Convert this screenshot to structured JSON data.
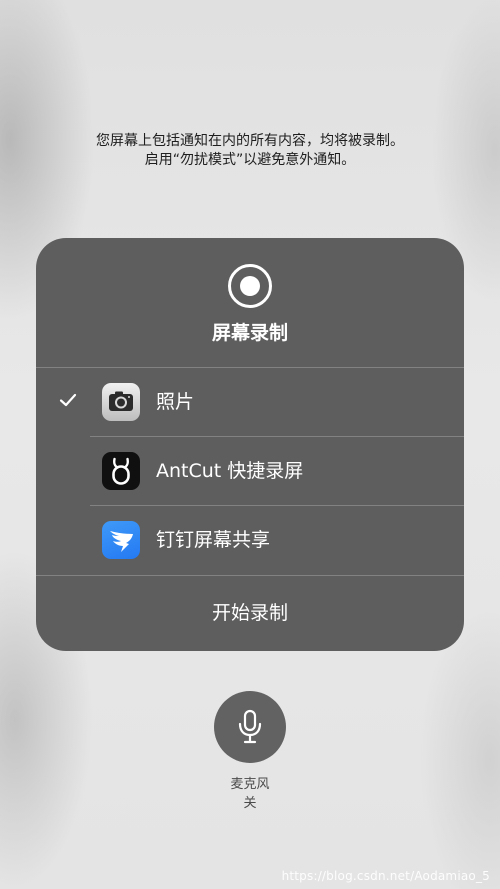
{
  "warning": {
    "line1": "您屏幕上包括通知在内的所有内容，均将被录制。",
    "line2": "启用“勿扰模式”以避免意外通知。"
  },
  "panel": {
    "icon": "record-icon",
    "title": "屏幕录制",
    "apps": [
      {
        "label": "照片",
        "icon": "photos-camera-icon",
        "selected": true
      },
      {
        "label": "AntCut 快捷录屏",
        "icon": "antcut-app-icon",
        "selected": false
      },
      {
        "label": "钉钉屏幕共享",
        "icon": "dingtalk-app-icon",
        "selected": false
      }
    ],
    "start_label": "开始录制"
  },
  "microphone": {
    "icon": "microphone-icon",
    "label_line1": "麦克风",
    "label_line2": "关"
  },
  "watermark": "https://blog.csdn.net/Aodamiao_5",
  "colors": {
    "panel_background": "#585858",
    "panel_text": "#ffffff",
    "dingtalk_blue": "#2f86f6"
  }
}
